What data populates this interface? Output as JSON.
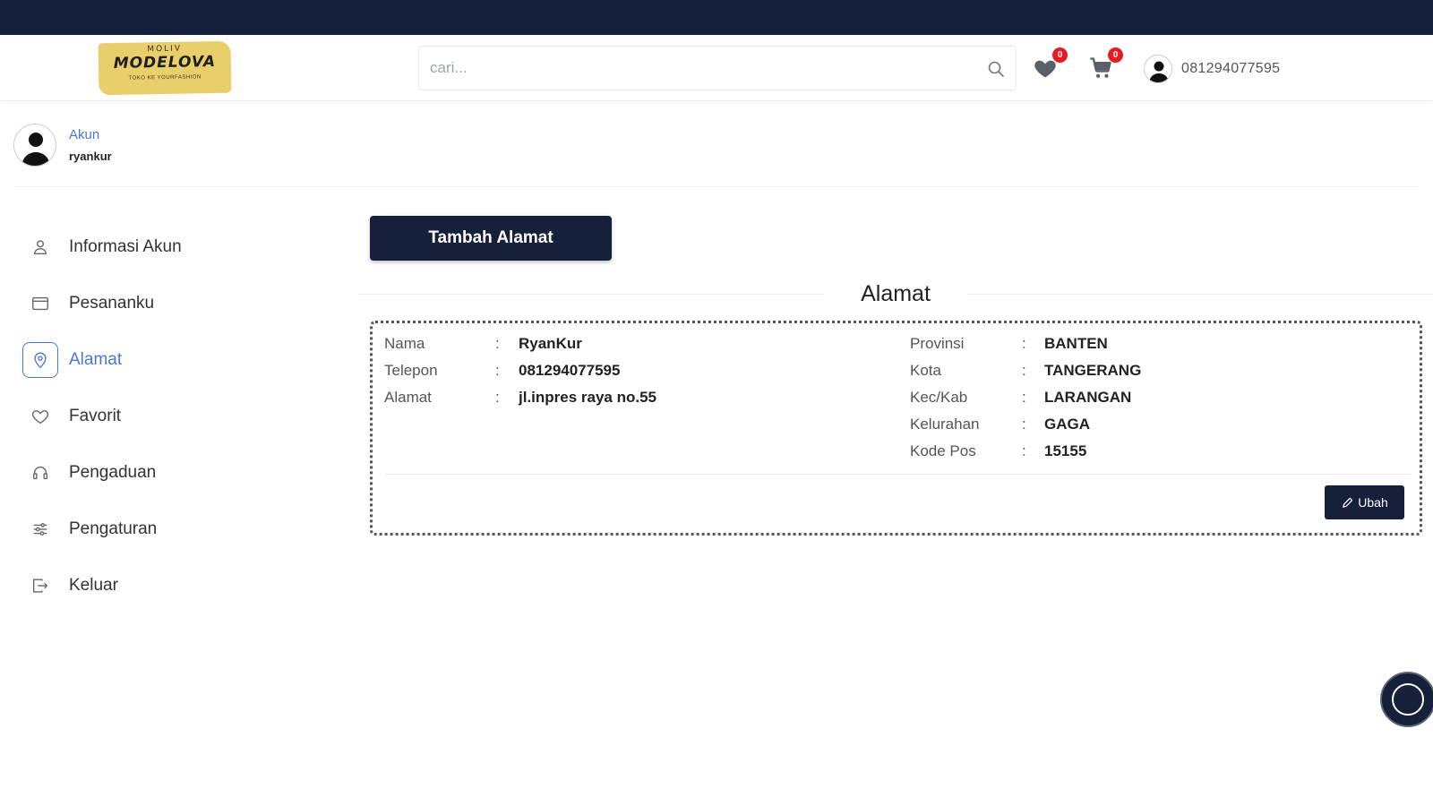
{
  "header": {
    "logo": {
      "top": "MOLIV",
      "main": "MODELOVA",
      "sub": "TOKO KE YOURFASHION"
    },
    "search": {
      "placeholder": "cari..."
    },
    "wishlist_count": "0",
    "cart_count": "0",
    "user_phone": "081294077595"
  },
  "profile": {
    "label": "Akun",
    "name": "ryankur"
  },
  "sidebar": {
    "items": [
      {
        "label": "Informasi Akun",
        "icon": "user-icon",
        "active": false
      },
      {
        "label": "Pesananku",
        "icon": "orders-icon",
        "active": false
      },
      {
        "label": "Alamat",
        "icon": "location-icon",
        "active": true
      },
      {
        "label": "Favorit",
        "icon": "heart-icon",
        "active": false
      },
      {
        "label": "Pengaduan",
        "icon": "headset-icon",
        "active": false
      },
      {
        "label": "Pengaturan",
        "icon": "settings-icon",
        "active": false
      },
      {
        "label": "Keluar",
        "icon": "logout-icon",
        "active": false
      }
    ]
  },
  "main": {
    "add_button": "Tambah Alamat",
    "section_title": "Alamat",
    "address": {
      "left": [
        {
          "label": "Nama",
          "value": "RyanKur"
        },
        {
          "label": "Telepon",
          "value": "081294077595"
        },
        {
          "label": "Alamat",
          "value": "jl.inpres raya no.55"
        }
      ],
      "right": [
        {
          "label": "Provinsi",
          "value": "BANTEN"
        },
        {
          "label": "Kota",
          "value": "TANGERANG"
        },
        {
          "label": "Kec/Kab",
          "value": "LARANGAN"
        },
        {
          "label": "Kelurahan",
          "value": "GAGA"
        },
        {
          "label": "Kode Pos",
          "value": "15155"
        }
      ],
      "colon": ":",
      "edit_button": "Ubah"
    }
  },
  "colors": {
    "navy": "#15213a",
    "accent_blue": "#4a78d8",
    "badge_red": "#e51c23",
    "logo_yellow": "#e9cf6c"
  }
}
